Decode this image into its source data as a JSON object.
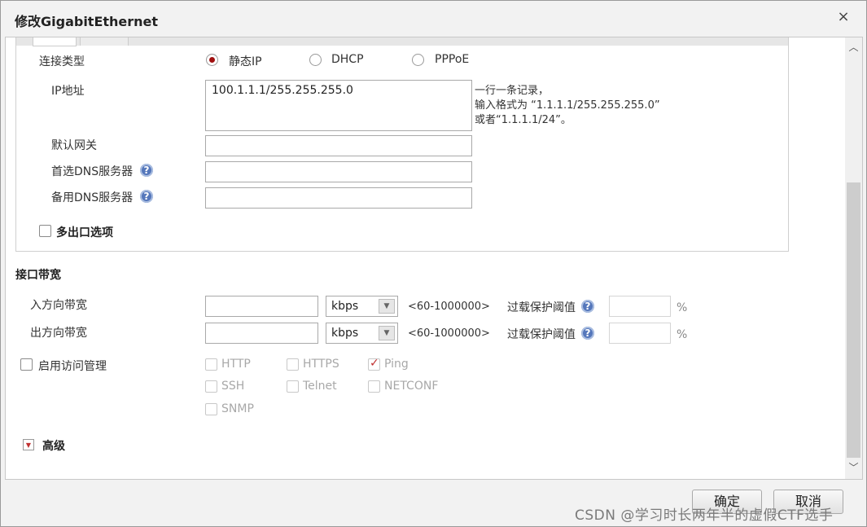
{
  "dialog": {
    "title": "修改GigabitEthernet",
    "close_label": "×"
  },
  "connection": {
    "label": "连接类型",
    "options": [
      {
        "label": "静态IP",
        "selected": true
      },
      {
        "label": "DHCP",
        "selected": false
      },
      {
        "label": "PPPoE",
        "selected": false
      }
    ]
  },
  "ip": {
    "label": "IP地址",
    "value": "100.1.1.1/255.255.255.0",
    "hint_lines": [
      "一行一条记录，",
      "输入格式为 “1.1.1.1/255.255.255.0”",
      "或者“1.1.1.1/24”。"
    ]
  },
  "gateway": {
    "label": "默认网关",
    "value": ""
  },
  "dns1": {
    "label": "首选DNS服务器",
    "value": ""
  },
  "dns2": {
    "label": "备用DNS服务器",
    "value": ""
  },
  "multi_exit": {
    "label": "多出口选项",
    "checked": false
  },
  "bandwidth": {
    "section_label": "接口带宽",
    "rows": [
      {
        "label": "入方向带宽",
        "value": "",
        "unit": "kbps",
        "range": "<60-1000000>",
        "threshold_label": "过载保护阈值",
        "pct": "%"
      },
      {
        "label": "出方向带宽",
        "value": "",
        "unit": "kbps",
        "range": "<60-1000000>",
        "threshold_label": "过载保护阈值",
        "pct": "%"
      }
    ]
  },
  "access": {
    "label": "启用访问管理",
    "checked": false,
    "protocols": [
      {
        "label": "HTTP",
        "checked": false
      },
      {
        "label": "HTTPS",
        "checked": false
      },
      {
        "label": "Ping",
        "checked": true
      },
      {
        "label": "SSH",
        "checked": false
      },
      {
        "label": "Telnet",
        "checked": false
      },
      {
        "label": "NETCONF",
        "checked": false
      },
      {
        "label": "SNMP",
        "checked": false
      }
    ]
  },
  "advanced": {
    "label": "高级"
  },
  "footer": {
    "ok_label": "确定",
    "cancel_label": "取消"
  },
  "watermark": "CSDN @学习时长两年半的虚假CTF选手",
  "colors": {
    "radio_selected": "#a01010",
    "help_icon": "#5577bb",
    "disabled_text": "#a8a8a8"
  }
}
